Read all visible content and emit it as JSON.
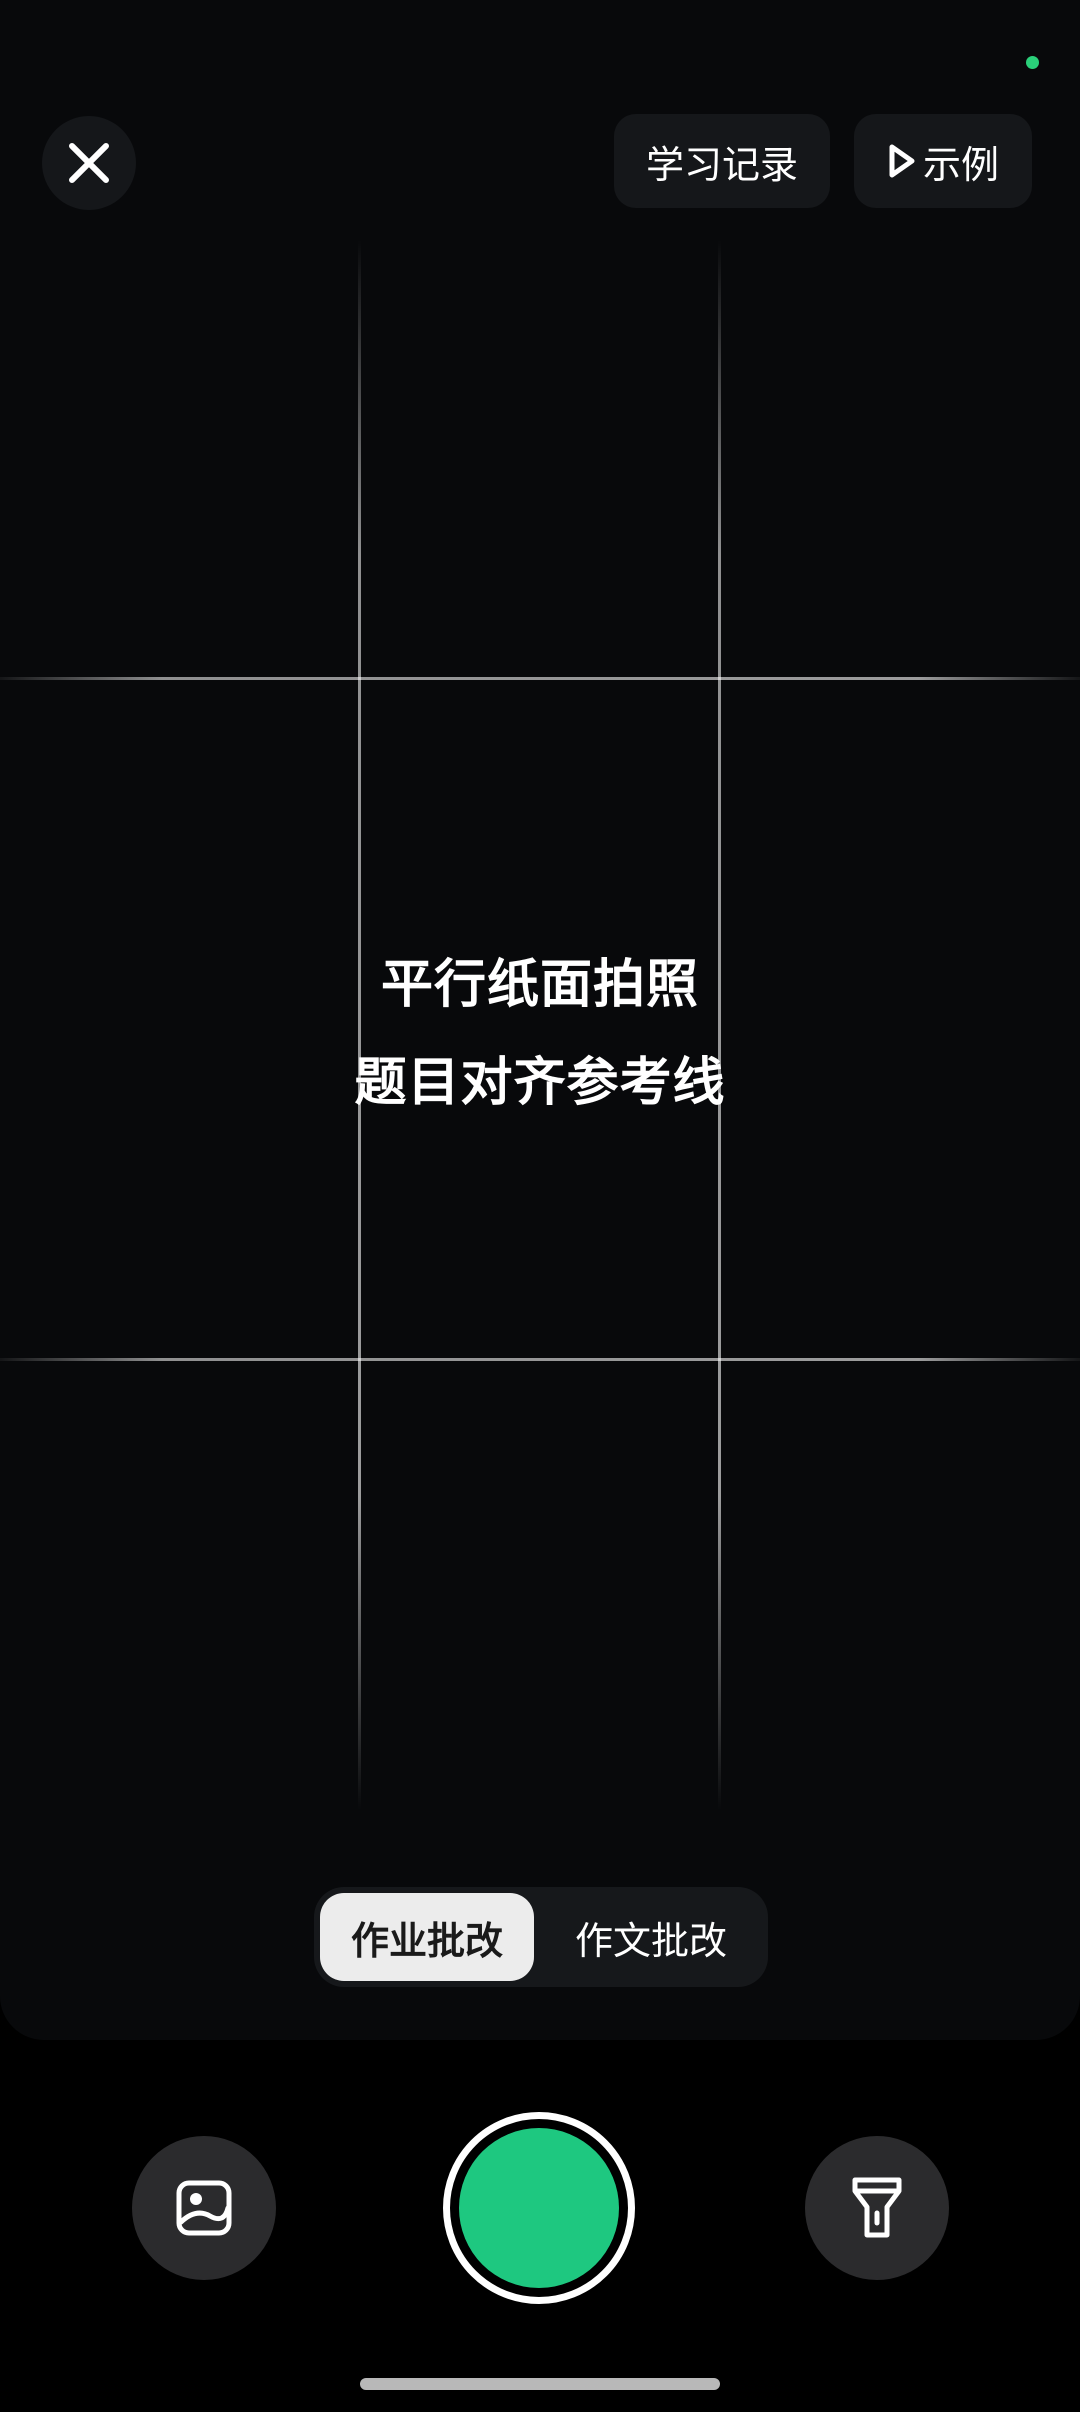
{
  "header": {
    "close_icon": "close-icon",
    "history_label": "学习记录",
    "example_label": "示例",
    "example_icon": "play-outline-icon"
  },
  "hint": {
    "line1": "平行纸面拍照",
    "line2": "题目对齐参考线"
  },
  "mode_switch": {
    "tabs": [
      {
        "label": "作业批改",
        "active": true
      },
      {
        "label": "作文批改",
        "active": false
      }
    ]
  },
  "controls": {
    "gallery_icon": "image-icon",
    "flash_icon": "flashlight-icon",
    "shutter_color": "#1ec880"
  },
  "colors": {
    "accent": "#1ec880",
    "status_dot": "#2ad07a"
  }
}
